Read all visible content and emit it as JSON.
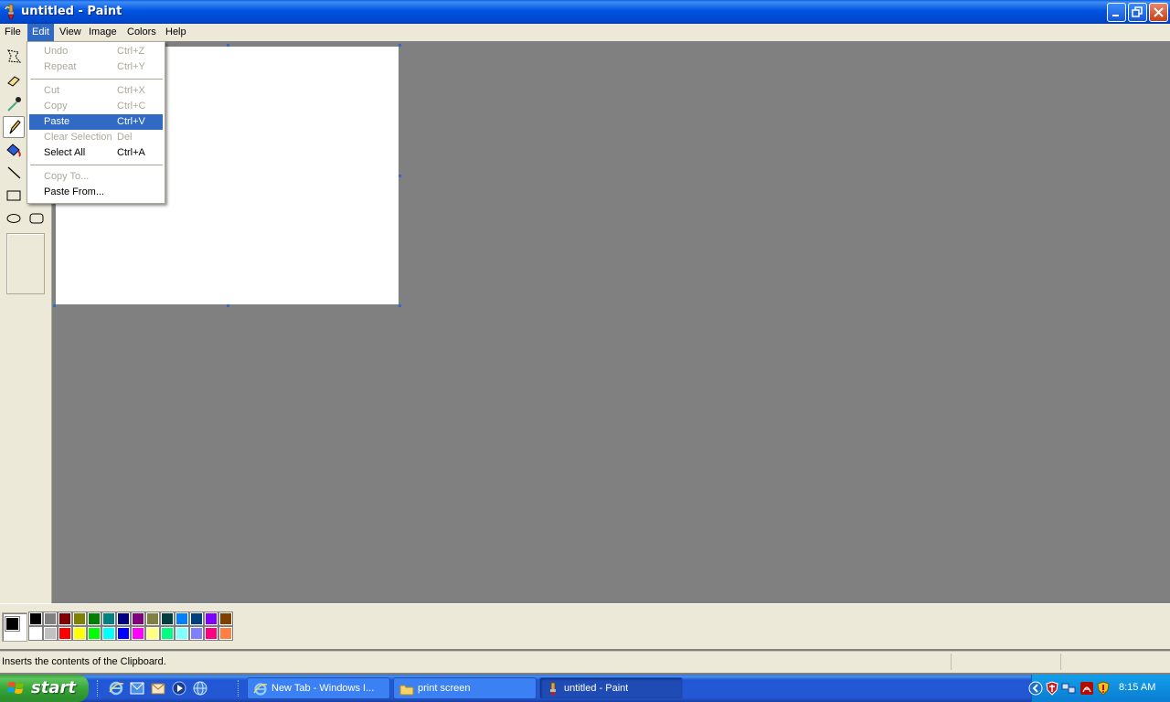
{
  "window": {
    "title": "untitled - Paint",
    "app_icon": "paint-brush-icon",
    "caption_buttons": [
      "minimize-icon",
      "restore-icon",
      "close-icon"
    ]
  },
  "menubar": {
    "items": [
      {
        "label": "File"
      },
      {
        "label": "Edit"
      },
      {
        "label": "View"
      },
      {
        "label": "Image"
      },
      {
        "label": "Colors"
      },
      {
        "label": "Help"
      }
    ],
    "active": "Edit"
  },
  "edit_menu": {
    "items": [
      {
        "label": "Undo",
        "shortcut": "Ctrl+Z",
        "enabled": false
      },
      {
        "label": "Repeat",
        "shortcut": "Ctrl+Y",
        "enabled": false
      },
      {
        "label": "Cut",
        "shortcut": "Ctrl+X",
        "enabled": false
      },
      {
        "label": "Copy",
        "shortcut": "Ctrl+C",
        "enabled": false
      },
      {
        "label": "Paste",
        "shortcut": "Ctrl+V",
        "enabled": true,
        "highlighted": true
      },
      {
        "label": "Clear Selection",
        "shortcut": "Del",
        "enabled": false
      },
      {
        "label": "Select All",
        "shortcut": "Ctrl+A",
        "enabled": true
      },
      {
        "label": "Copy To...",
        "shortcut": "",
        "enabled": false
      },
      {
        "label": "Paste From...",
        "shortcut": "",
        "enabled": true
      }
    ]
  },
  "toolbox": {
    "tools": [
      "free-form-select-icon",
      "eraser-icon",
      "pick-color-icon",
      "pencil-icon",
      "fill-icon",
      "line-icon",
      "rectangle-icon",
      "ellipse-icon",
      "rounded-rectangle-icon"
    ],
    "selected": "pencil-icon"
  },
  "palette": {
    "foreground": "#000000",
    "background": "#ffffff",
    "row1": [
      "#000000",
      "#808080",
      "#800000",
      "#808000",
      "#008000",
      "#008080",
      "#000080",
      "#800080",
      "#808040",
      "#004040",
      "#0080ff",
      "#004080",
      "#8000ff",
      "#804000"
    ],
    "row2": [
      "#ffffff",
      "#c0c0c0",
      "#ff0000",
      "#ffff00",
      "#00ff00",
      "#00ffff",
      "#0000ff",
      "#ff00ff",
      "#ffff80",
      "#00ff80",
      "#80ffff",
      "#8080ff",
      "#ff0080",
      "#ff8040"
    ]
  },
  "statusbar": {
    "text": "Inserts the contents of the Clipboard."
  },
  "taskbar": {
    "start_label": "start",
    "quick_launch": [
      "internet-explorer-icon",
      "outlook-express-icon",
      "mail-icon",
      "media-player-icon",
      "globe-icon"
    ],
    "tasks": [
      {
        "label": "New Tab - Windows I...",
        "icon": "internet-explorer-icon",
        "active": false
      },
      {
        "label": "print screen",
        "icon": "folder-icon",
        "active": false
      },
      {
        "label": "untitled - Paint",
        "icon": "paint-brush-icon",
        "active": true
      }
    ],
    "tray_icons": [
      "chevron-left-icon",
      "shield-icon",
      "network-icon",
      "acrobat-icon",
      "security-icon"
    ],
    "clock": "8:15 AM"
  }
}
